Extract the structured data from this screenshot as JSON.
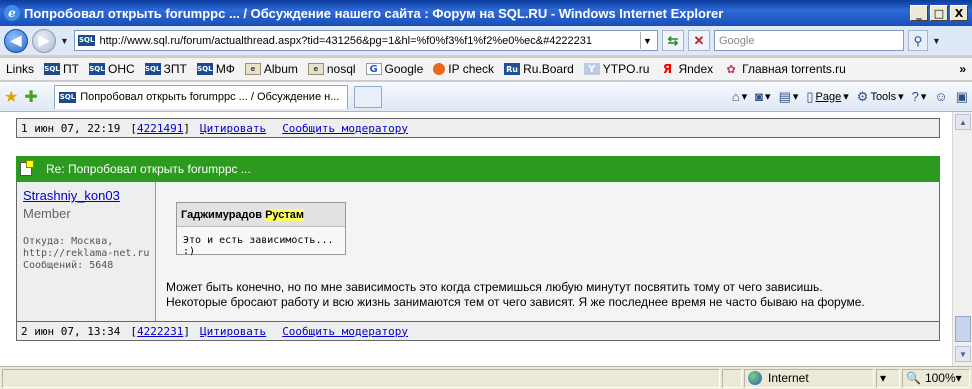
{
  "window": {
    "title": "Попробовал открыть forumppc ... / Обсуждение нашего сайта : Форум на SQL.RU - Windows Internet Explorer",
    "buttons": [
      "_",
      "□",
      "X"
    ]
  },
  "address_bar": {
    "url": "http://www.sql.ru/forum/actualthread.aspx?tid=431256&pg=1&hl=%f0%f3%f1%f2%e0%ec&#4222231",
    "search_placeholder": "Google"
  },
  "links_bar": {
    "label": "Links",
    "items": [
      {
        "icon": "SQL",
        "label": "ПТ"
      },
      {
        "icon": "SQL",
        "label": "ОНС"
      },
      {
        "icon": "SQL",
        "label": "ЗПТ"
      },
      {
        "icon": "SQL",
        "label": "МФ"
      },
      {
        "icon": "page",
        "label": "Album"
      },
      {
        "icon": "page",
        "label": "nosql"
      },
      {
        "icon": "G",
        "label": "Google"
      },
      {
        "icon": "ip",
        "label": "IP check"
      },
      {
        "icon": "Ru",
        "label": "Ru.Board"
      },
      {
        "icon": "Y",
        "label": "YTPO.ru"
      },
      {
        "icon": "Я",
        "label": "Яndex"
      },
      {
        "icon": "torrent",
        "label": "Главная torrents.ru"
      }
    ]
  },
  "command_bar": {
    "tab_title": "Попробовал открыть forumppc ... / Обсуждение н...",
    "page_label": "Page",
    "tools_label": "Tools"
  },
  "thread": {
    "prev_footer": {
      "date": "1 июн 07, 22:19",
      "id": "4221491",
      "quote_link": "Цитировать",
      "report_link": "Сообщить модератору"
    },
    "message": {
      "subject": "Re: Попробовал открыть forumppc ...",
      "author": "Strashniy_kon03",
      "role": "Member",
      "from": "Откуда: Москва,",
      "site": "http://reklama-net.ru",
      "posts": "Сообщений: 5648",
      "quote_author_first": "Гаджимурадов",
      "quote_author_highlight": "Рустам",
      "quote_text": "Это и есть зависимость... :)",
      "line1": "Может быть конечно, но по мне зависимость это когда стремишься любую минутут посвятить тому от чего зависишь.",
      "line2": "Некоторые бросают работу и всю жизнь занимаются тем от чего зависят. Я же последнее время не часто бываю на форуме.",
      "footer_date": "2 июн 07, 13:34",
      "footer_id": "4222231",
      "quote_link": "Цитировать",
      "report_link": "Сообщить модератору"
    }
  },
  "status_bar": {
    "zone": "Internet",
    "zoom": "100%"
  }
}
